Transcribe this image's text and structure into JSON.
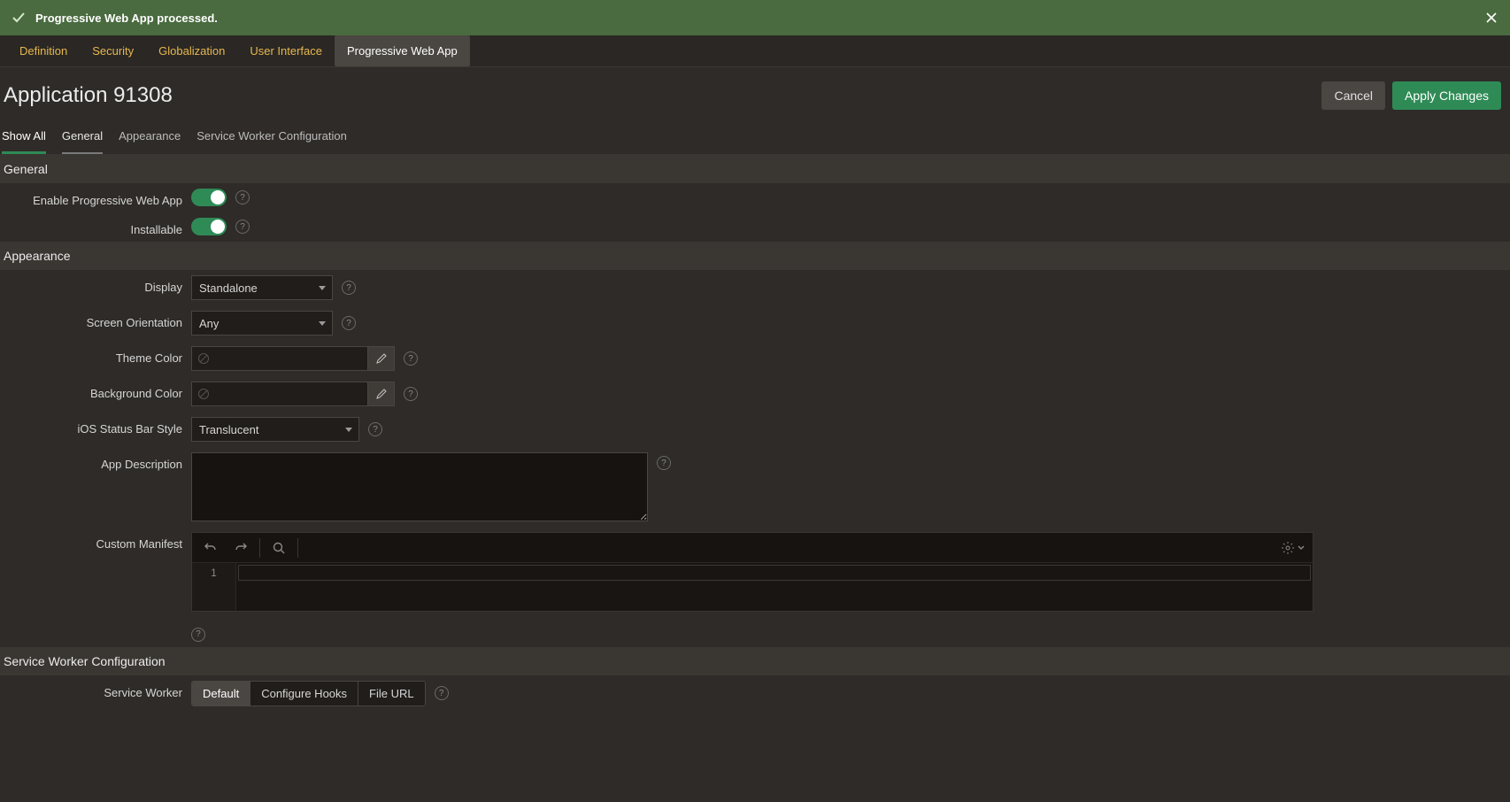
{
  "notification": {
    "message": "Progressive Web App processed."
  },
  "topTabs": {
    "items": [
      "Definition",
      "Security",
      "Globalization",
      "User Interface",
      "Progressive Web App"
    ],
    "activeIndex": 4
  },
  "page": {
    "title": "Application 91308",
    "cancel": "Cancel",
    "apply": "Apply Changes"
  },
  "subTabs": {
    "items": [
      "Show All",
      "General",
      "Appearance",
      "Service Worker Configuration"
    ]
  },
  "sections": {
    "general": {
      "header": "General",
      "enablePwaLabel": "Enable Progressive Web App",
      "installableLabel": "Installable"
    },
    "appearance": {
      "header": "Appearance",
      "displayLabel": "Display",
      "displayValue": "Standalone",
      "orientationLabel": "Screen Orientation",
      "orientationValue": "Any",
      "themeColorLabel": "Theme Color",
      "bgColorLabel": "Background Color",
      "iosStatusLabel": "iOS Status Bar Style",
      "iosStatusValue": "Translucent",
      "appDescLabel": "App Description",
      "customManifestLabel": "Custom Manifest",
      "codeLine": "1"
    },
    "swc": {
      "header": "Service Worker Configuration",
      "swLabel": "Service Worker",
      "segments": [
        "Default",
        "Configure Hooks",
        "File URL"
      ]
    }
  }
}
